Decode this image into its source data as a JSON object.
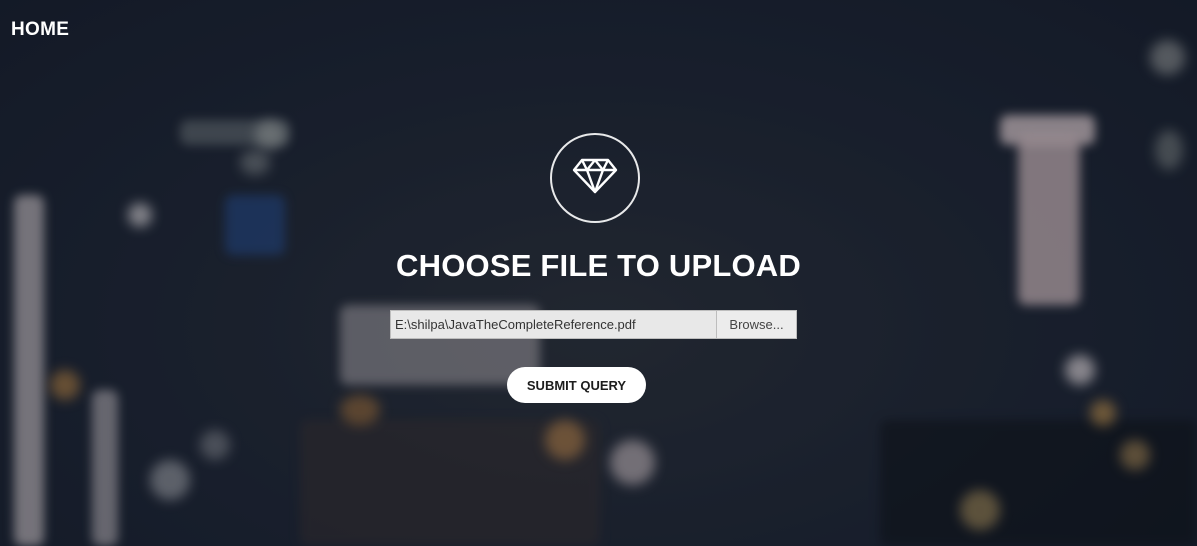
{
  "nav": {
    "home_label": "HOME"
  },
  "logo": {
    "icon": "diamond-icon"
  },
  "upload": {
    "title": "CHOOSE FILE TO UPLOAD",
    "file_path": "E:\\shilpa\\JavaTheCompleteReference.pdf",
    "browse_label": "Browse...",
    "submit_label": "SUBMIT QUERY"
  },
  "colors": {
    "background": "#1b2331",
    "text": "#ffffff",
    "button_bg": "#ffffff",
    "input_bg": "#e8e8e8"
  }
}
